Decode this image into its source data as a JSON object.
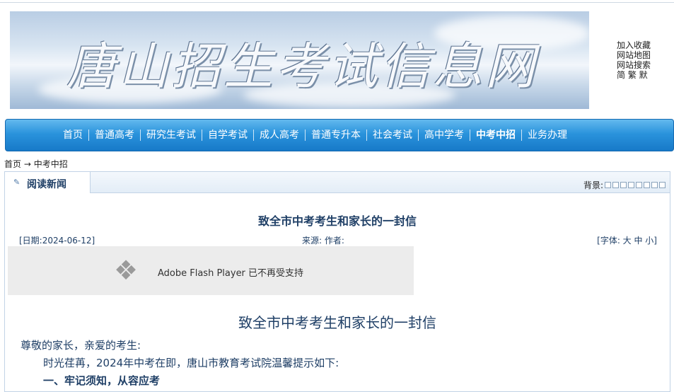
{
  "banner": {
    "title": "唐山招生考试信息网"
  },
  "quick_links": [
    "加入收藏",
    "网站地图",
    "网站搜索",
    "简 繁 默"
  ],
  "nav": {
    "items": [
      "首页",
      "普通高考",
      "研究生考试",
      "自学考试",
      "成人高考",
      "普通专升本",
      "社会考试",
      "高中学考",
      "中考中招",
      "业务办理"
    ],
    "active": "中考中招"
  },
  "breadcrumb": {
    "home": "首页",
    "arrow": "→",
    "current": "中考中招"
  },
  "panel": {
    "tab_label": "阅读新闻",
    "bg_label": "背景:"
  },
  "article": {
    "title": "致全市中考考生和家长的一封信",
    "date": "[日期:2024-06-12]",
    "source_author": "来源:  作者:",
    "font_size": "[字体: 大 中 小]",
    "flash_message": "Adobe Flash Player 已不再受支持",
    "heading": "致全市中考考生和家长的一封信",
    "greeting": "尊敬的家长，亲爱的考生:",
    "para1": "时光荏苒，2024年中考在即，唐山市教育考试院温馨提示如下:",
    "section1": "一、牢记须知，从容应考"
  },
  "colors": {
    "nav_blue": "#2a93dc",
    "text_navy": "#1f3f66"
  }
}
